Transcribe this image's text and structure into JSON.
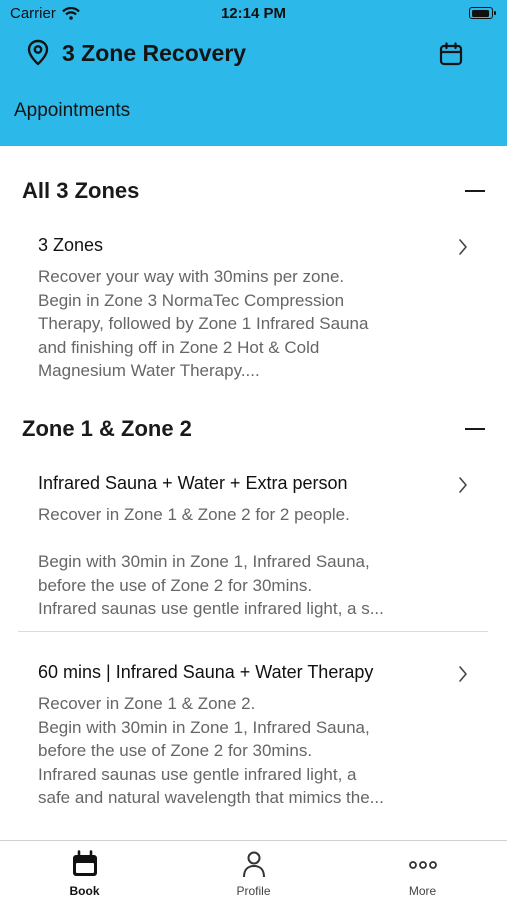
{
  "status_bar": {
    "carrier": "Carrier",
    "time": "12:14 PM"
  },
  "header": {
    "title": "3 Zone Recovery",
    "subtitle": "Appointments"
  },
  "sections": [
    {
      "title": "All 3 Zones",
      "items": [
        {
          "name": "3 Zones",
          "description": "Recover your way with 30mins per zone.\nBegin in Zone 3 NormaTec Compression\nTherapy, followed by Zone 1 Infrared Sauna\nand finishing off in Zone 2 Hot & Cold\nMagnesium Water Therapy...."
        }
      ]
    },
    {
      "title": "Zone 1 & Zone 2",
      "items": [
        {
          "name": "Infrared Sauna + Water + Extra person",
          "description": "Recover in Zone 1 & Zone 2 for 2 people.\n\nBegin with 30min in Zone 1, Infrared Sauna,\nbefore the use of Zone 2 for 30mins.\nInfrared saunas use gentle infrared light, a s..."
        },
        {
          "name": "60 mins | Infrared Sauna + Water Therapy",
          "description": "Recover in Zone 1 & Zone 2.\nBegin with 30min in Zone 1, Infrared Sauna,\nbefore the use of Zone 2 for 30mins.\nInfrared saunas use gentle infrared light, a\nsafe and natural wavelength that mimics the..."
        }
      ]
    }
  ],
  "tabs": [
    {
      "label": "Book",
      "icon": "calendar-icon",
      "active": true
    },
    {
      "label": "Profile",
      "icon": "person-icon",
      "active": false
    },
    {
      "label": "More",
      "icon": "more-dots-icon",
      "active": false
    }
  ],
  "colors": {
    "header_bg": "#2db8ea",
    "description_text": "#666666"
  }
}
